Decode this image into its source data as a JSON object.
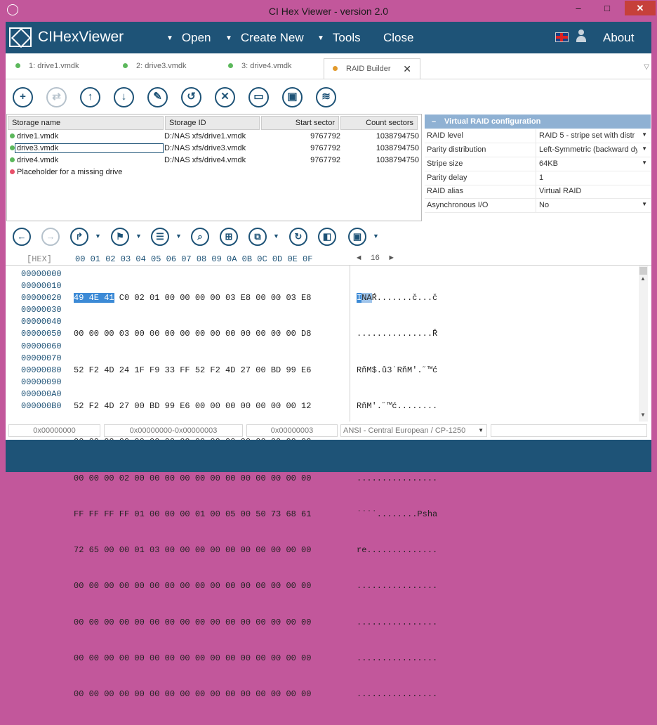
{
  "window": {
    "title": "CI Hex Viewer - version 2.0",
    "minimize": "–",
    "maximize": "□",
    "close": "✕"
  },
  "menubar": {
    "brand": "CIHexViewer",
    "items": [
      {
        "label": "Open",
        "has_dropdown": true
      },
      {
        "label": "Create New",
        "has_dropdown": true
      },
      {
        "label": "Tools",
        "has_dropdown": true
      },
      {
        "label": "Close",
        "has_dropdown": false
      }
    ],
    "about": "About",
    "icons": [
      "uk-flag-icon",
      "user-icon"
    ]
  },
  "tabs": [
    {
      "label": "1: drive1.vmdk",
      "dot": "#5cb85c"
    },
    {
      "label": "2: drive3.vmdk",
      "dot": "#5cb85c"
    },
    {
      "label": "3: drive4.vmdk",
      "dot": "#5cb85c"
    },
    {
      "label": "RAID Builder",
      "dot": "#e29a2b",
      "active": true
    }
  ],
  "toolbar": {
    "buttons": [
      "add-icon",
      "merge-icon",
      "move-up-icon",
      "move-down-icon",
      "edit-icon",
      "undo-icon",
      "delete-icon",
      "open-folder-icon",
      "save-icon",
      "layers-icon"
    ]
  },
  "storage": {
    "headers": {
      "name": "Storage name",
      "id": "Storage ID",
      "start": "Start sector",
      "count": "Count sectors"
    },
    "rows": [
      {
        "name": "drive1.vmdk",
        "id": "D:/NAS xfs/drive1.vmdk",
        "start": "9767792",
        "count": "1038794750",
        "status": "ok"
      },
      {
        "name": "drive3.vmdk",
        "id": "D:/NAS xfs/drive3.vmdk",
        "start": "9767792",
        "count": "1038794750",
        "status": "ok"
      },
      {
        "name": "drive4.vmdk",
        "id": "D:/NAS xfs/drive4.vmdk",
        "start": "9767792",
        "count": "1038794750",
        "status": "ok"
      },
      {
        "name": "Placeholder for a missing drive",
        "id": "",
        "start": "",
        "count": "",
        "status": "missing"
      }
    ]
  },
  "raid": {
    "title": "Virtual RAID configuration",
    "props": [
      {
        "key": "RAID level",
        "value": "RAID 5 - stripe set with distr",
        "dropdown": true
      },
      {
        "key": "Parity distribution",
        "value": "Left-Symmetric (backward dy",
        "dropdown": true
      },
      {
        "key": "Stripe size",
        "value": "64KB",
        "dropdown": true
      },
      {
        "key": "Parity delay",
        "value": "1",
        "dropdown": false
      },
      {
        "key": "RAID alias",
        "value": "Virtual RAID",
        "dropdown": false
      },
      {
        "key": "Asynchronous I/O",
        "value": "No",
        "dropdown": true
      }
    ]
  },
  "hex": {
    "mode": "[HEX]",
    "columns": "00 01 02 03 04 05 06 07 08 09 0A 0B 0C 0D 0E 0F",
    "width_prev": "◄",
    "width": "16",
    "width_next": "►",
    "offsets": [
      "00000000",
      "00000010",
      "00000020",
      "00000030",
      "00000040",
      "00000050",
      "00000060",
      "00000070",
      "00000080",
      "00000090",
      "000000A0",
      "000000B0"
    ],
    "row0_hl": "49 4E 41",
    "row0_rest": " C0 02 01 00 00 00 00 03 E8 00 00 03 E8",
    "rows": [
      "00 00 00 03 00 00 00 00 00 00 00 00 00 00 00 D8",
      "52 F2 4D 24 1F F9 33 FF 52 F2 4D 27 00 BD 99 E6",
      "52 F2 4D 27 00 BD 99 E6 00 00 00 00 00 00 00 12",
      "00 00 00 00 00 00 00 00 00 00 00 00 00 00 00 00",
      "00 00 00 02 00 00 00 00 00 00 00 00 00 00 00 00",
      "FF FF FF FF 01 00 00 00 01 00 05 00 50 73 68 61",
      "72 65 00 00 01 03 00 00 00 00 00 00 00 00 00 00",
      "00 00 00 00 00 00 00 00 00 00 00 00 00 00 00 00",
      "00 00 00 00 00 00 00 00 00 00 00 00 00 00 00 00",
      "00 00 00 00 00 00 00 00 00 00 00 00 00 00 00 00",
      "00 00 00 00 00 00 00 00 00 00 00 00 00 00 00 00"
    ],
    "ascii0_hl1": "I",
    "ascii0_hl2": "NA",
    "ascii0_rest": "Ŕ.......č...č",
    "ascii": [
      "...............Ř",
      "RňM$.ů3˙RňM'.˝™ć",
      "RňM'.˝™ć........",
      "................",
      "................",
      "˙˙˙˙........Psha",
      "re..............",
      "................",
      "................",
      "................",
      "................"
    ]
  },
  "navbar": {
    "buttons": [
      "back-icon",
      "forward-icon",
      "goto-icon",
      "bookmark-icon",
      "list-icon",
      "search-icon",
      "select-block-icon",
      "copy-icon",
      "refresh-icon",
      "panel-icon",
      "save-icon"
    ]
  },
  "status": {
    "offset": "0x00000000",
    "selection": "0x00000000-0x00000003",
    "length": "0x00000003",
    "encoding": "ANSI - Central European / CP-1250",
    "extra": ""
  }
}
